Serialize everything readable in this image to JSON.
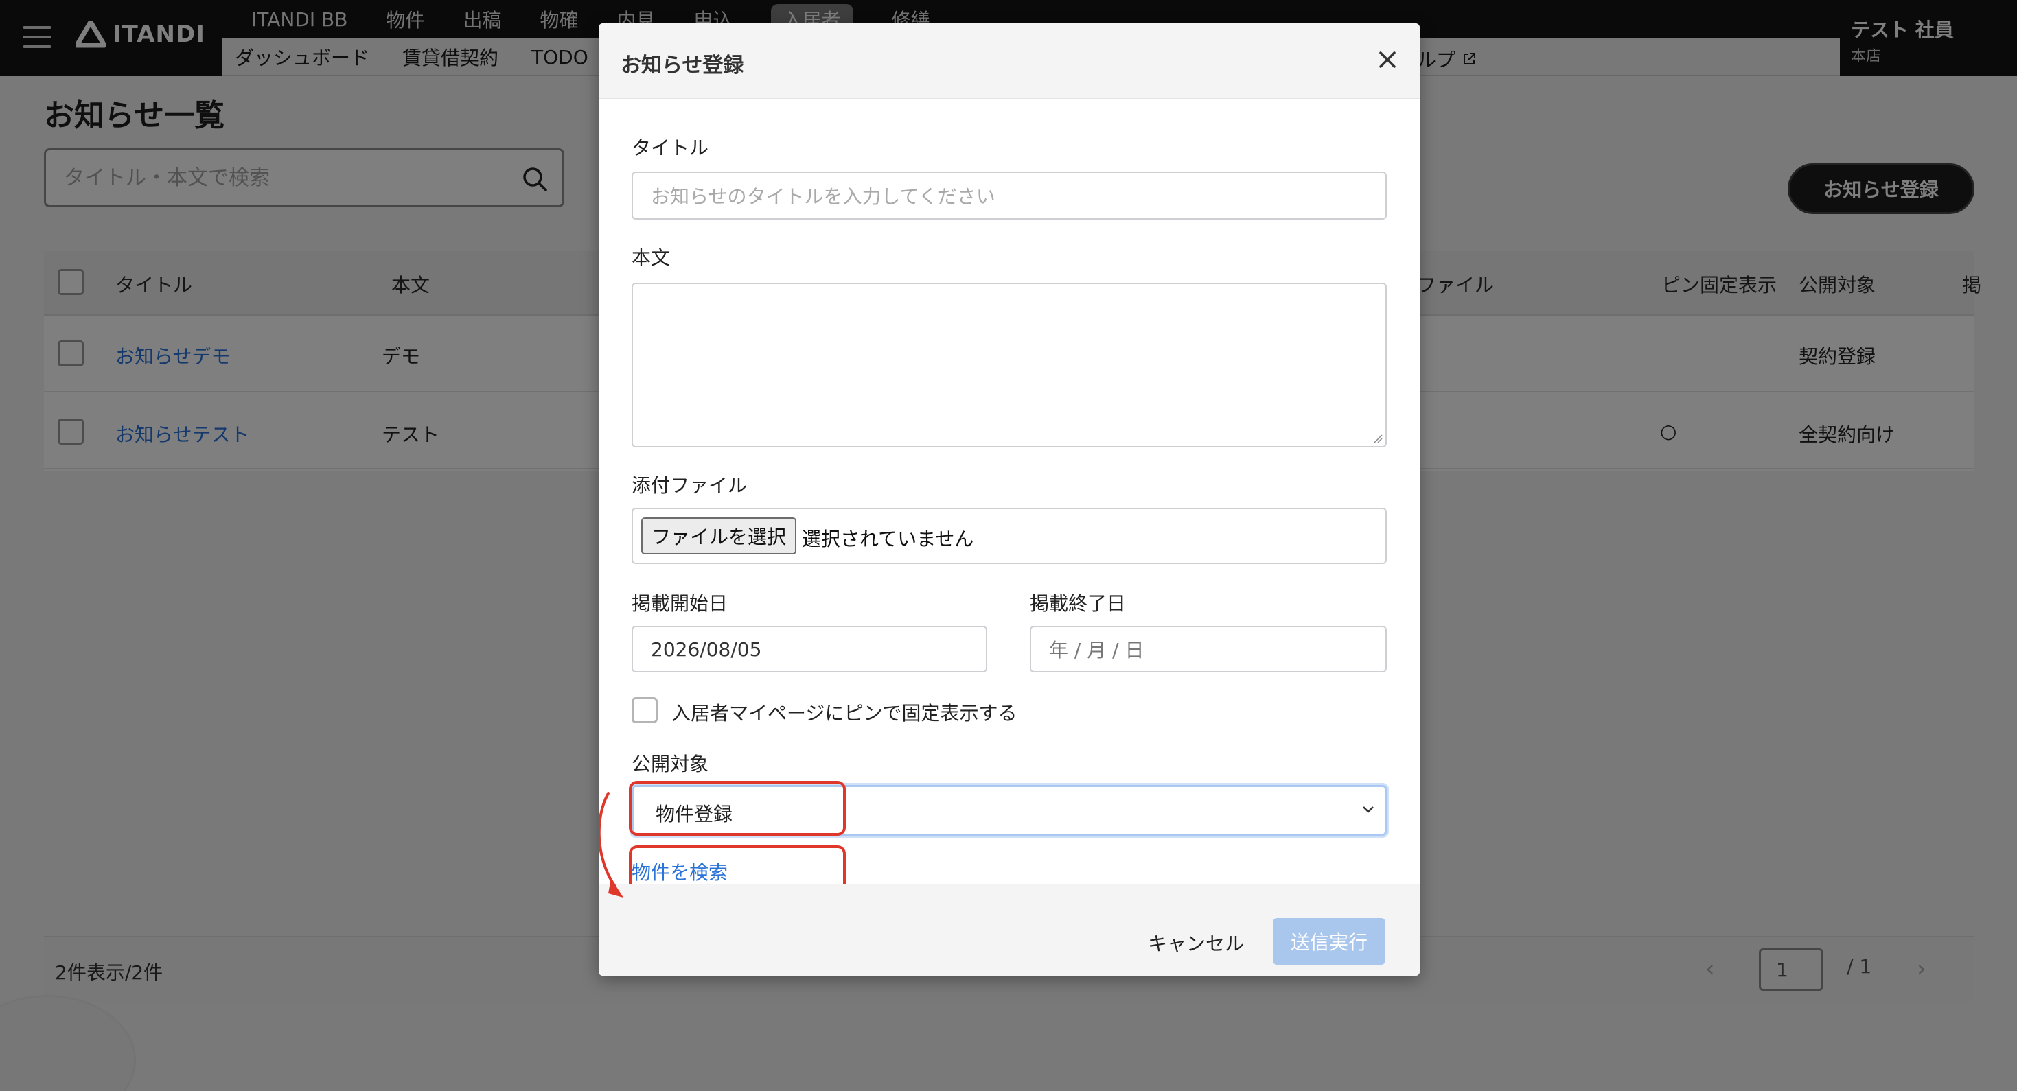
{
  "header": {
    "logo_text": "ITANDI",
    "tabs_primary": [
      "ITANDI BB",
      "物件",
      "出稿",
      "物確",
      "内見",
      "申込",
      "入居者",
      "修繕"
    ],
    "active_tab": "入居者",
    "tabs_secondary": [
      "ダッシュボード",
      "賃貸借契約",
      "TODO"
    ],
    "help_label": "ルプ",
    "user_name": "テスト 社員",
    "user_branch": "本店"
  },
  "page": {
    "title": "お知らせ一覧",
    "search_placeholder": "タイトル・本文で検索",
    "register_button": "お知らせ登録"
  },
  "table": {
    "columns": [
      "タイトル",
      "本文",
      "ファイル",
      "ピン固定表示",
      "公開対象",
      "掲"
    ],
    "rows": [
      {
        "title": "お知らせデモ",
        "body": "デモ",
        "pin": "",
        "target": "契約登録"
      },
      {
        "title": "お知らせテスト",
        "body": "テスト",
        "pin": "○",
        "target": "全契約向け"
      }
    ]
  },
  "footer": {
    "count": "2件表示/2件",
    "page_input": "1",
    "page_total": "/ 1",
    "prev": "‹",
    "next": "›"
  },
  "modal": {
    "title": "お知らせ登録",
    "title_label": "タイトル",
    "title_placeholder": "お知らせのタイトルを入力してください",
    "body_label": "本文",
    "file_label": "添付ファイル",
    "file_button": "ファイルを選択",
    "file_status": "選択されていません",
    "start_date_label": "掲載開始日",
    "start_date_value": "2026/08/05",
    "end_date_label": "掲載終了日",
    "end_date_placeholder": "年 / 月 / 日",
    "pin_checkbox_label": "入居者マイページにピンで固定表示する",
    "target_label": "公開対象",
    "target_value": "物件登録",
    "search_property_link": "物件を検索",
    "cancel_button": "キャンセル",
    "submit_button": "送信実行"
  },
  "colors": {
    "header_bg": "#151515",
    "link": "#2a73d8",
    "annotation_red": "#e0372b",
    "submit_disabled": "#a9c6ec"
  }
}
